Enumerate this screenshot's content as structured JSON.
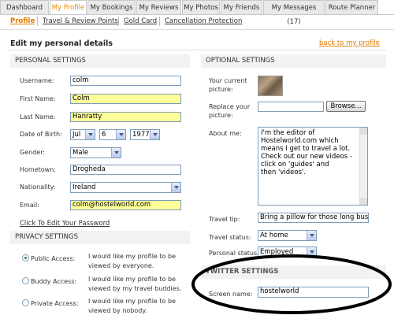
{
  "tabs": [
    {
      "label": "Dashboard",
      "active": false
    },
    {
      "label": "My Profile",
      "active": true
    },
    {
      "label": "My Bookings",
      "active": false
    },
    {
      "label": "My Reviews",
      "active": false
    },
    {
      "label": "My Photos",
      "active": false
    },
    {
      "label": "My Friends",
      "active": false
    },
    {
      "label": "My Messages (17)",
      "active": false
    },
    {
      "label": "Route Planner",
      "active": false
    }
  ],
  "subtabs": [
    {
      "label": "Profile",
      "active": true
    },
    {
      "label": "Travel & Review Points",
      "active": false
    },
    {
      "label": "Gold Card",
      "active": false
    },
    {
      "label": "Cancellation Protection",
      "active": false
    }
  ],
  "page": {
    "title": "Edit my personal details",
    "back_link": "back to my profile"
  },
  "personal": {
    "heading": "PERSONAL SETTINGS",
    "username_label": "Username:",
    "username": "colm",
    "first_name_label": "First Name:",
    "first_name": "Colm",
    "last_name_label": "Last Name:",
    "last_name": "Hanratty",
    "dob_label": "Date of Birth:",
    "dob_month": "Jul",
    "dob_day": "6",
    "dob_year": "1977",
    "gender_label": "Gender:",
    "gender": "Male",
    "hometown_label": "Hometown:",
    "hometown": "Drogheda",
    "nationality_label": "Nationality:",
    "nationality": "Ireland",
    "email_label": "Email:",
    "email": "colm@hostelworld.com",
    "edit_password_link": "Click To Edit Your Password"
  },
  "privacy": {
    "heading": "PRIVACY SETTINGS",
    "options": [
      {
        "label": "Public Access:",
        "desc1": "I would like my profile to be",
        "desc2": "viewed by everyone.",
        "selected": true
      },
      {
        "label": "Buddy Access:",
        "desc1": "I would like my profile to be",
        "desc2": "viewed by my travel buddies.",
        "selected": false
      },
      {
        "label": "Private Access:",
        "desc1": "I would like my profile to be",
        "desc2": "viewed by nobody.",
        "selected": false
      }
    ]
  },
  "optional": {
    "heading": "OPTIONAL SETTINGS",
    "picture_label_1": "Your current",
    "picture_label_2": "picture:",
    "replace_label_1": "Replace your",
    "replace_label_2": "picture:",
    "browse_label": "Browse...",
    "about_label": "About me:",
    "about_lines": [
      "I'm the editor of",
      "Hostelworld.com which",
      "means I get to travel a lot.",
      "Check out our new videos -",
      "click on 'guides' and",
      "then 'videos'."
    ],
    "tip_label": "Travel tip:",
    "tip": "Bring a pillow for those long bus journ",
    "status_label": "Travel status:",
    "status": "At home",
    "personal_status_label": "Personal status:",
    "personal_status": "Employed"
  },
  "twitter": {
    "heading": "TWITTER SETTINGS",
    "screen_name_label": "Screen name:",
    "screen_name": "hostelworld"
  },
  "colors": {
    "accent": "#f08a00",
    "highlight_field": "#ffff99",
    "section_bg": "#f2f2f2"
  }
}
